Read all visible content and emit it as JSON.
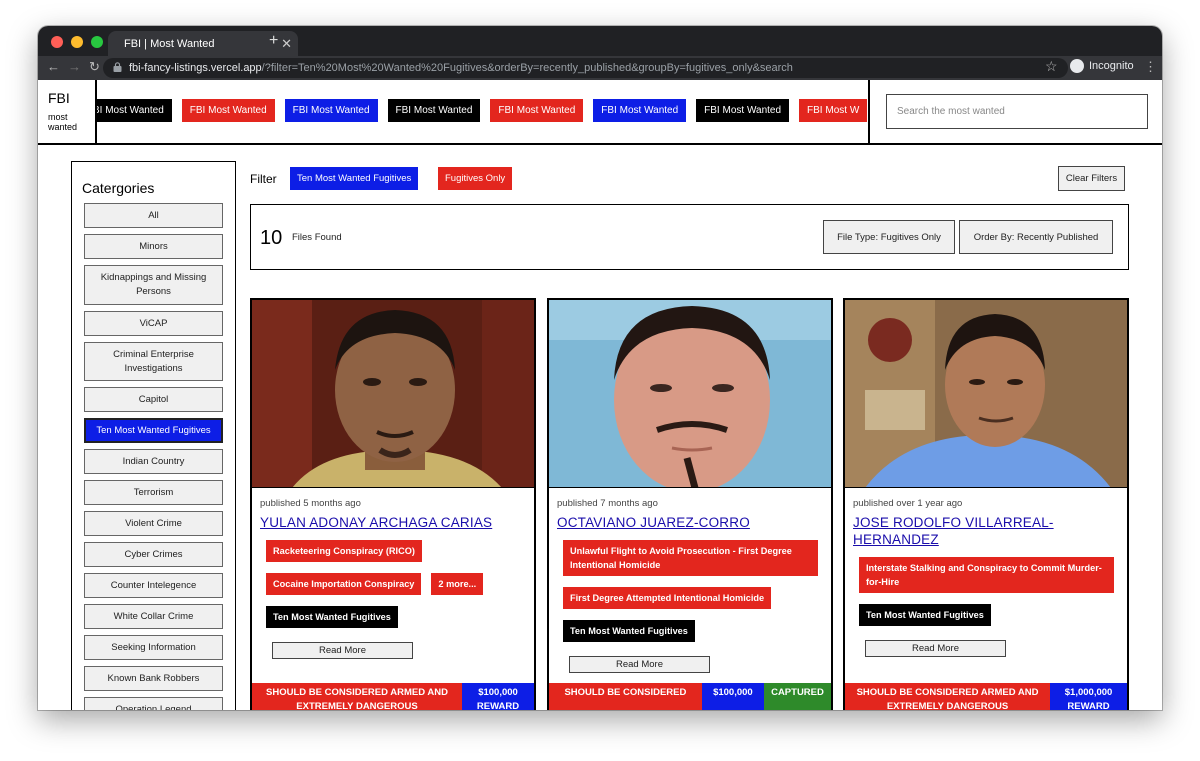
{
  "browser": {
    "tab_title": "FBI | Most Wanted",
    "url_host": "fbi-fancy-listings.vercel.app",
    "url_rest": "/?filter=Ten%20Most%20Wanted%20Fugitives&orderBy=recently_published&groupBy=fugitives_only&search",
    "incognito_label": "Incognito"
  },
  "header": {
    "logo_title": "FBI",
    "logo_sub": "most wanted",
    "marquee_first": "BI Most Wanted",
    "marquee_item": "FBI Most Wanted",
    "marquee_last": "FBI Most W",
    "search_placeholder": "Search the most wanted"
  },
  "sidebar": {
    "title": "Catergories",
    "items": [
      "All",
      "Minors",
      "Kidnappings and Missing Persons",
      "ViCAP",
      "Criminal Enterprise Investigations",
      "Capitol",
      "Ten Most Wanted Fugitives",
      "Indian Country",
      "Terrorism",
      "Violent Crime",
      "Cyber Crimes",
      "Counter Intelegence",
      "White Collar Crime",
      "Seeking Information",
      "Known Bank Robbers",
      "Operation Legend"
    ],
    "active_index": 6
  },
  "filters": {
    "label": "Filter",
    "chips": [
      "Ten Most Wanted Fugitives",
      "Fugitives Only"
    ],
    "clear_label": "Clear Filters"
  },
  "results": {
    "count": "10",
    "label": "Files Found",
    "file_type_label": "File Type: Fugitives Only",
    "order_label": "Order By: Recently Published"
  },
  "cards": [
    {
      "published": "published 5 months ago",
      "name": "YULAN ADONAY ARCHAGA CARIAS",
      "tags": [
        "Racketeering Conspiracy (RICO)",
        "Cocaine Importation Conspiracy",
        "2 more..."
      ],
      "category": "Ten Most Wanted Fugitives",
      "read_more": "Read More",
      "warning": "SHOULD BE CONSIDERED ARMED AND EXTREMELY DANGEROUS",
      "reward_amount": "$100,000",
      "reward_label": "REWARD"
    },
    {
      "published": "published 7 months ago",
      "name": "OCTAVIANO JUAREZ-CORRO",
      "tags": [
        "Unlawful Flight to Avoid Prosecution - First Degree Intentional Homicide",
        "First Degree Attempted Intentional Homicide"
      ],
      "category": "Ten Most Wanted Fugitives",
      "read_more": "Read More",
      "warning": "SHOULD BE CONSIDERED",
      "reward_amount": "$100,000",
      "status": "CAPTURED"
    },
    {
      "published": "published over 1 year ago",
      "name": "JOSE RODOLFO VILLARREAL-HERNANDEZ",
      "tags": [
        "Interstate Stalking and Conspiracy to Commit Murder-for-Hire"
      ],
      "category": "Ten Most Wanted Fugitives",
      "read_more": "Read More",
      "warning": "SHOULD BE CONSIDERED ARMED AND EXTREMELY DANGEROUS",
      "reward_amount": "$1,000,000",
      "reward_label": "REWARD"
    }
  ],
  "colors": {
    "red": "#e3261e",
    "blue": "#0d1ee6",
    "black": "#000000",
    "green": "#2e8a2a",
    "link": "#1a0dab"
  }
}
